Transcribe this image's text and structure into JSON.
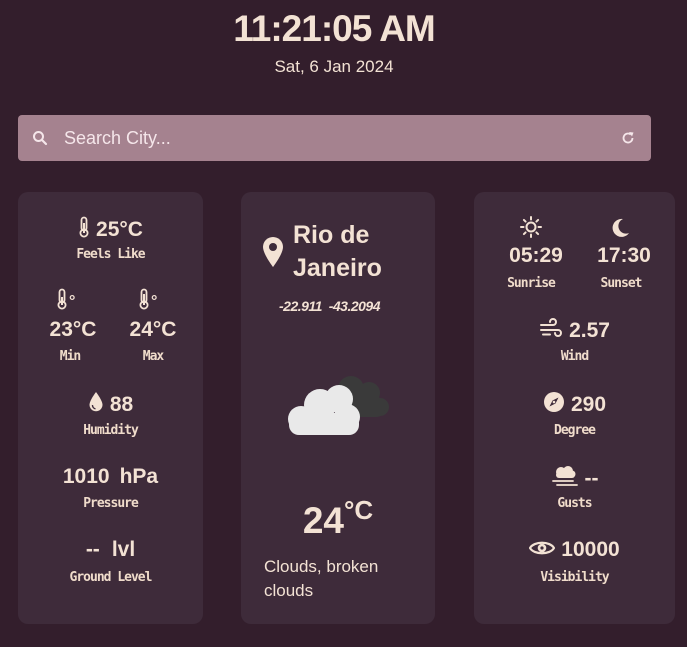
{
  "header": {
    "time": "11:21:05 AM",
    "date": "Sat, 6 Jan 2024"
  },
  "search": {
    "placeholder": "Search City...",
    "value": ""
  },
  "left": {
    "feels_like_value": "25°C",
    "feels_like_label": "Feels Like",
    "min_deg": "°",
    "max_deg": "°",
    "min_value": "23°C",
    "min_label": "Min",
    "max_value": "24°C",
    "max_label": "Max",
    "humidity_value": "88",
    "humidity_label": "Humidity",
    "pressure_value": "1010",
    "pressure_unit": "hPa",
    "pressure_label": "Pressure",
    "ground_value": "--",
    "ground_unit": "lvl",
    "ground_label": "Ground Level"
  },
  "center": {
    "city_line1": "Rio de",
    "city_line2": "Janeiro",
    "lat": "-22.911",
    "lon": "-43.2094",
    "temp_value": "24",
    "temp_unit": "°C",
    "description": "Clouds, broken clouds"
  },
  "right": {
    "sunrise_value": "05:29",
    "sunrise_label": "Sunrise",
    "sunset_value": "17:30",
    "sunset_label": "Sunset",
    "wind_value": "2.57",
    "wind_label": "Wind",
    "degree_value": "290",
    "degree_label": "Degree",
    "gusts_value": "--",
    "gusts_label": "Gusts",
    "visibility_value": "10000",
    "visibility_label": "Visibility"
  },
  "icons": [
    "search-icon",
    "refresh-icon",
    "thermometer-icon",
    "water-drop-icon",
    "location-pin-icon",
    "cloud-icon",
    "sun-icon",
    "moon-icon",
    "wind-icon",
    "compass-icon",
    "gust-icon",
    "eye-icon"
  ],
  "colors": {
    "background": "#331e2c",
    "card": "#3e2b3a",
    "search_bar": "#a5828f",
    "text": "#f3e2d4"
  }
}
